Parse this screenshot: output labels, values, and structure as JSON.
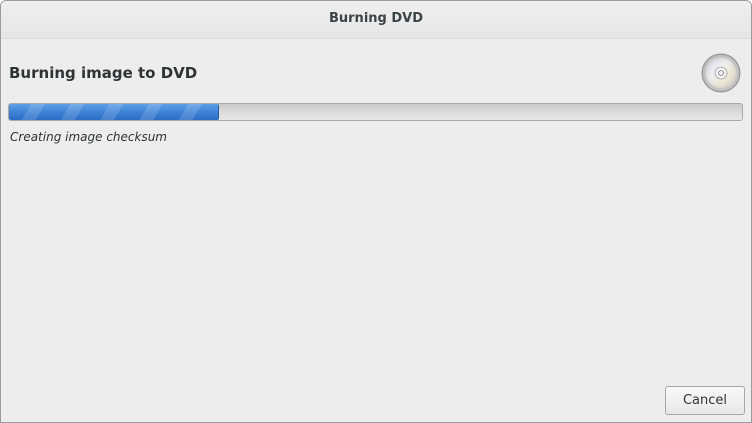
{
  "window": {
    "title": "Burning DVD"
  },
  "main": {
    "heading": "Burning image to DVD",
    "status_text": "Creating image checksum",
    "disc_icon": "optical-disc-icon"
  },
  "progress": {
    "fraction": 0.285,
    "fill_color": "#3e82d6"
  },
  "actions": {
    "cancel_label": "Cancel"
  }
}
